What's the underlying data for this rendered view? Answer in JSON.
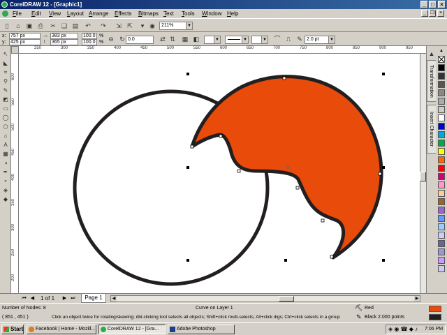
{
  "window": {
    "title": "CorelDRAW 12 - [Graphic1]"
  },
  "menu": [
    "File",
    "Edit",
    "View",
    "Layout",
    "Arrange",
    "Effects",
    "Bitmaps",
    "Text",
    "Tools",
    "Window",
    "Help"
  ],
  "toolbar": {
    "zoom": "211%"
  },
  "property_bar": {
    "x": "757 px",
    "y": "425 px",
    "width": "383 px",
    "height": "365 px",
    "scale_x": "100.0",
    "scale_y": "100.0",
    "percent": "%",
    "rotation": "0.0",
    "outline_width": "2.0 pt"
  },
  "rulers": {
    "units": "pixels",
    "top_ticks": [
      "250",
      "300",
      "350",
      "400",
      "450",
      "500",
      "550",
      "600",
      "650",
      "700",
      "750",
      "800",
      "850",
      "900",
      "950"
    ],
    "left_ticks": [
      "600",
      "550",
      "500",
      "450",
      "400",
      "350",
      "300",
      "250",
      "200"
    ]
  },
  "dockers": [
    "Transformation",
    "Insert Character"
  ],
  "palette_colors": [
    "#000000",
    "#333333",
    "#555555",
    "#888888",
    "#aaaaaa",
    "#cccccc",
    "#ffffff",
    "#0000cc",
    "#00aadd",
    "#00aa44",
    "#ffff00",
    "#ff6600",
    "#ff0000",
    "#cc0077",
    "#ff99cc",
    "#ffcc99",
    "#996633",
    "#9966cc",
    "#6699ff",
    "#99ccff",
    "#ccccff",
    "#666699",
    "#9999cc",
    "#cc99ff",
    "#ccccee"
  ],
  "shapes": {
    "circle_fill": "#ffffff",
    "crescent_fill": "#e84b0a",
    "outline": "#231f20"
  },
  "pages": {
    "counter": "1 of 1",
    "tab": "Page 1"
  },
  "status": {
    "nodes": "Number of Nodes: 8",
    "object": "Curve on Layer 1",
    "coords": "( 851 , 451 )",
    "hint": "Click an object twice for rotating/skewing; dbl-clicking tool selects all objects; Shift+click multi-selects; Alt+click digs; Ctrl+click selects in a group",
    "fill_name": "Red",
    "outline_name": "Black  2.000 points",
    "fill_color": "#e84b0a",
    "outline_color": "#231f20"
  },
  "taskbar": {
    "start": "Start",
    "tasks": [
      "Facebook | Home - Mozill...",
      "CorelDRAW 12 - [Gra...",
      "Adobe Photoshop"
    ],
    "clock": "7:06 PM"
  }
}
